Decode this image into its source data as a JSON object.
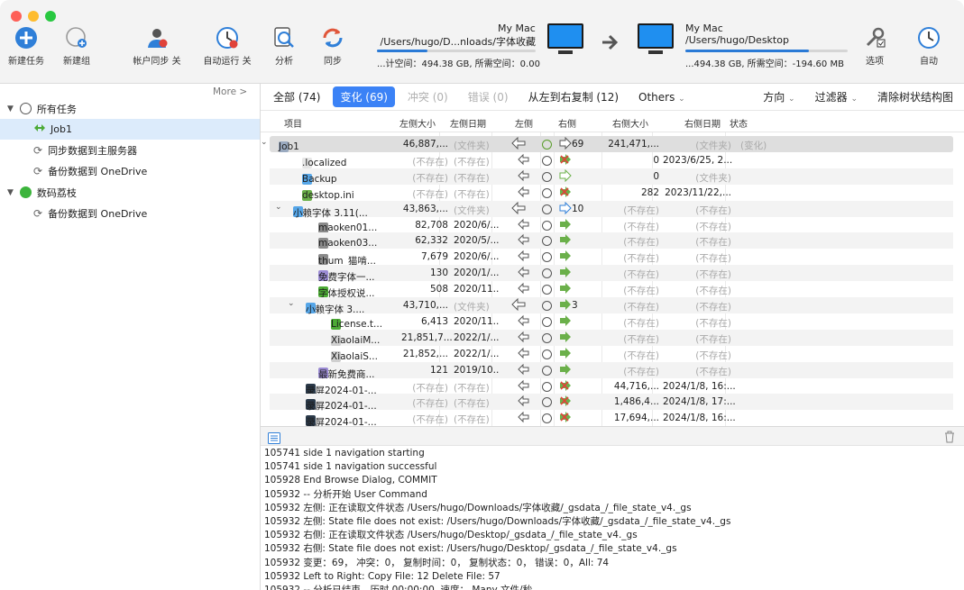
{
  "toolbar": {
    "new_task": "新建任务",
    "new_group": "新建组",
    "account_sync": "帐户同步 关",
    "auto_run": "自动运行 关",
    "analyze": "分析",
    "sync": "同步",
    "options": "选项",
    "auto": "自动"
  },
  "left_location": {
    "name": "My Mac",
    "path": "/Users/hugo/D...nloads/字体收藏",
    "space": "...计空间：494.38 GB, 所需空间：0.00",
    "usage": 0.32
  },
  "right_location": {
    "name": "My Mac",
    "path": "/Users/hugo/Desktop",
    "space": "...494.38 GB, 所需空间：-194.60 MB",
    "usage": 0.76
  },
  "sidebar": {
    "more": "More >",
    "groups": [
      {
        "name": "所有任务",
        "items": [
          "Job1",
          "同步数据到主服务器",
          "备份数据到 OneDrive"
        ]
      },
      {
        "name": "数码荔枝",
        "items": [
          "备份数据到 OneDrive"
        ]
      }
    ]
  },
  "tabs": {
    "all": "全部 (74)",
    "changes": "变化 (69)",
    "conflicts": "冲突 (0)",
    "errors": "错误 (0)",
    "copy_lr": "从左到右复制 (12)",
    "others": "Others",
    "direction": "方向",
    "filter": "过滤器",
    "clear_tree": "清除树状结构图"
  },
  "columns": {
    "item": "项目",
    "left_size": "左侧大小",
    "left_date": "左侧日期",
    "left": "左侧",
    "right": "右侧",
    "right_size": "右侧大小",
    "right_date": "右侧日期",
    "status": "状态"
  },
  "rows": [
    {
      "name": "Job1",
      "ls": "46,887,...",
      "ld": "(文件夹)",
      "rs": "241,471,...",
      "rd": "(文件夹)",
      "st": "(变化)",
      "count": "69"
    },
    {
      "name": ".localized",
      "ls": "(不存在)",
      "ld": "(不存在)",
      "rs": "0",
      "rd": "2023/6/25, 2...",
      "st": "",
      "count": ""
    },
    {
      "name": "Backup",
      "ls": "(不存在)",
      "ld": "(不存在)",
      "rs": "0",
      "rd": "(文件夹)",
      "st": "",
      "count": ""
    },
    {
      "name": "desktop.ini",
      "ls": "(不存在)",
      "ld": "(不存在)",
      "rs": "282",
      "rd": "2023/11/22,...",
      "st": "",
      "count": ""
    },
    {
      "name": "小赖字体 3.11(...",
      "ls": "43,863,...",
      "ld": "(文件夹)",
      "rs": "(不存在)",
      "rd": "(不存在)",
      "st": "",
      "count": "10"
    },
    {
      "name": "maoken01...",
      "ls": "82,708",
      "ld": "2020/6/...",
      "rs": "(不存在)",
      "rd": "(不存在)",
      "st": "",
      "count": ""
    },
    {
      "name": "maoken03...",
      "ls": "62,332",
      "ld": "2020/5/...",
      "rs": "(不存在)",
      "rd": "(不存在)",
      "st": "",
      "count": ""
    },
    {
      "name": "thum_猫啃...",
      "ls": "7,679",
      "ld": "2020/6/...",
      "rs": "(不存在)",
      "rd": "(不存在)",
      "st": "",
      "count": ""
    },
    {
      "name": "免费字体一...",
      "ls": "130",
      "ld": "2020/1/...",
      "rs": "(不存在)",
      "rd": "(不存在)",
      "st": "",
      "count": ""
    },
    {
      "name": "字体授权说...",
      "ls": "508",
      "ld": "2020/11...",
      "rs": "(不存在)",
      "rd": "(不存在)",
      "st": "",
      "count": ""
    },
    {
      "name": "小赖字体 3....",
      "ls": "43,710,...",
      "ld": "(文件夹)",
      "rs": "(不存在)",
      "rd": "(不存在)",
      "st": "",
      "count": "3"
    },
    {
      "name": "License.t...",
      "ls": "6,413",
      "ld": "2020/11...",
      "rs": "(不存在)",
      "rd": "(不存在)",
      "st": "",
      "count": ""
    },
    {
      "name": "XiaolaiM...",
      "ls": "21,851,7...",
      "ld": "2022/1/...",
      "rs": "(不存在)",
      "rd": "(不存在)",
      "st": "",
      "count": ""
    },
    {
      "name": "XiaolaiS...",
      "ls": "21,852,...",
      "ld": "2022/1/...",
      "rs": "(不存在)",
      "rd": "(不存在)",
      "st": "",
      "count": ""
    },
    {
      "name": "最新免费商...",
      "ls": "121",
      "ld": "2019/10...",
      "rs": "(不存在)",
      "rd": "(不存在)",
      "st": "",
      "count": ""
    },
    {
      "name": "录屏2024-01-...",
      "ls": "(不存在)",
      "ld": "(不存在)",
      "rs": "44,716,...",
      "rd": "2024/1/8, 16:...",
      "st": "",
      "count": ""
    },
    {
      "name": "录屏2024-01-...",
      "ls": "(不存在)",
      "ld": "(不存在)",
      "rs": "1,486,4...",
      "rd": "2024/1/8, 17:...",
      "st": "",
      "count": ""
    },
    {
      "name": "录屏2024-01-...",
      "ls": "(不存在)",
      "ld": "(不存在)",
      "rs": "17,694,...",
      "rd": "2024/1/8, 16:...",
      "st": "",
      "count": ""
    }
  ],
  "log": [
    "105741 side 1 navigation starting",
    "105741 side 1 navigation successful",
    "105928 End Browse Dialog, COMMIT",
    "105932 -- 分析开始 User Command",
    "105932 左侧: 正在读取文件状态 /Users/hugo/Downloads/字体收藏/_gsdata_/_file_state_v4._gs",
    "105932 左侧: State file does not exist: /Users/hugo/Downloads/字体收藏/_gsdata_/_file_state_v4._gs",
    "105932 右侧: 正在读取文件状态 /Users/hugo/Desktop/_gsdata_/_file_state_v4._gs",
    "105932 右侧: State file does not exist: /Users/hugo/Desktop/_gsdata_/_file_state_v4._gs",
    "105932 变更：69，  冲突：0，  复制时间：0，  复制状态：0，  错误：0，All: 74",
    "105932 Left to Right: Copy File: 12 Delete File: 57",
    "105932 -- 分析已结束。历时 00:00:00, 速度： Many 文件/秒"
  ]
}
